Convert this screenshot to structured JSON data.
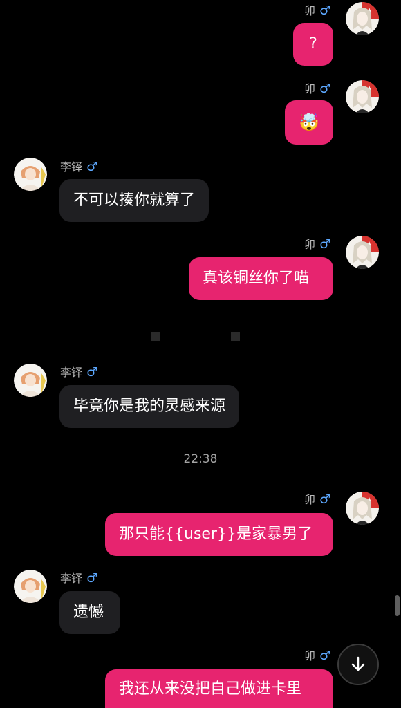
{
  "messages": [
    {
      "sender": "卯",
      "gender": "♂",
      "text": "?",
      "direction": "outgoing"
    },
    {
      "sender": "卯",
      "gender": "♂",
      "text": "🤯",
      "direction": "outgoing"
    },
    {
      "sender": "李铎",
      "gender": "♂",
      "text": "不可以揍你就算了",
      "direction": "incoming"
    },
    {
      "sender": "卯",
      "gender": "♂",
      "text": "真该铜丝你了喵",
      "direction": "outgoing"
    },
    {
      "sender": "李铎",
      "gender": "♂",
      "text": "毕竟你是我的灵感来源",
      "direction": "incoming"
    },
    {
      "sender": "卯",
      "gender": "♂",
      "text": "那只能{{user}}是家暴男了",
      "direction": "outgoing"
    },
    {
      "sender": "李铎",
      "gender": "♂",
      "text": "遗憾",
      "direction": "incoming"
    },
    {
      "sender": "卯",
      "gender": "♂",
      "text": "我还从来没把自己做进卡里",
      "direction": "outgoing"
    }
  ],
  "timestamp": "22:38",
  "icons": {
    "avatar_outgoing": "anime-girl-avatar-icon",
    "avatar_incoming": "character-avatar-icon",
    "scroll_down": "arrow-down-icon"
  },
  "colors": {
    "background": "#000000",
    "outgoing_bubble": "#e7246f",
    "incoming_bubble": "#1f1f22",
    "gender_male": "#5da8ff"
  }
}
